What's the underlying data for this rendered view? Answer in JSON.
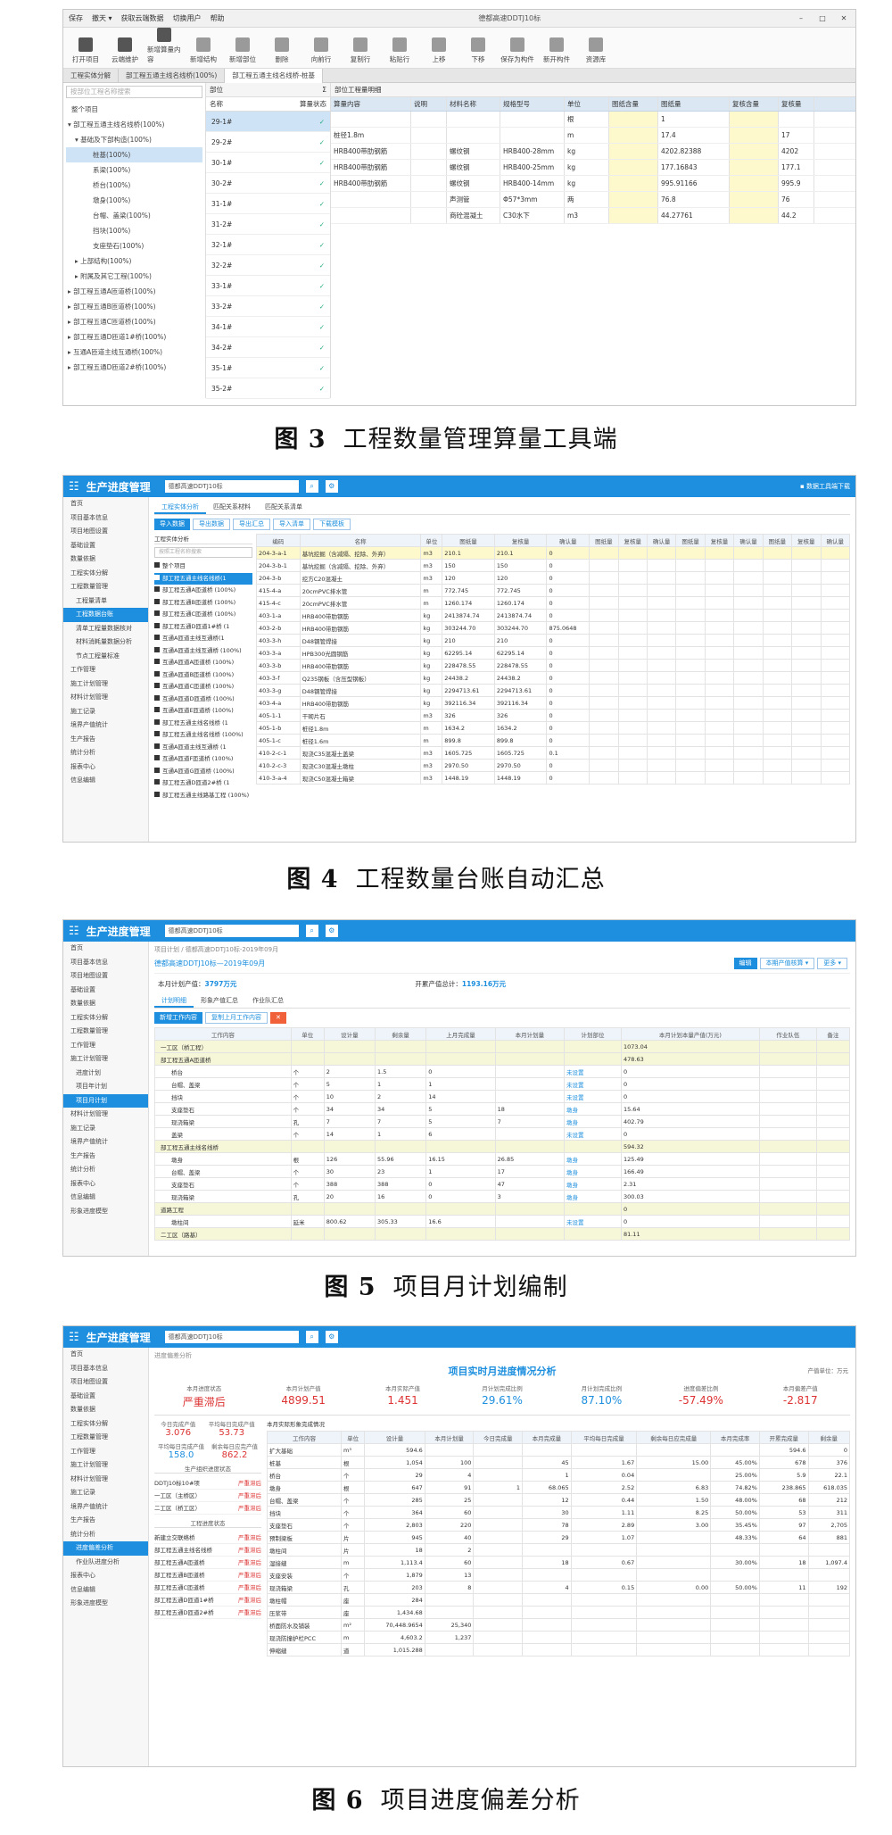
{
  "fig3": {
    "window_title": "德都高速DDTJ10标",
    "menu": [
      "保存",
      "撤天 ▾",
      "获取云端数据",
      "切换用户",
      "帮助"
    ],
    "ribbon": [
      "打开项目",
      "云端维护",
      "新增算量内容",
      "新增结构",
      "新增部位",
      "删除",
      "向前行",
      "复制行",
      "粘贴行",
      "上移",
      "下移",
      "保存为构件",
      "新开构件",
      "资源库"
    ],
    "tabs": [
      "工程实体分解",
      "部工程五通主线名线桥(100%)",
      "部工程五通主线名线桥-桩基"
    ],
    "tree_search": "按部位工程名称搜索",
    "tree": [
      "整个项目",
      "▾ 部工程五通主线名线桥(100%)",
      "▾ 基础及下部构造(100%)",
      "桩基(100%)",
      "系梁(100%)",
      "桥台(100%)",
      "墩身(100%)",
      "台帽、盖梁(100%)",
      "挡块(100%)",
      "支座垫石(100%)",
      "▸ 上部结构(100%)",
      "▸ 附属及其它工程(100%)",
      "▸ 部工程五通A匝道桥(100%)",
      "▸ 部工程五通B匝道桥(100%)",
      "▸ 部工程五通C匝道桥(100%)",
      "▸ 部工程五通D匝道1#桥(100%)",
      "▸ 互通A匝道主线互通桥(100%)",
      "▸ 部工程五通D匝道2#桥(100%)"
    ],
    "parts_header": "部位",
    "parts_cols": [
      "名称",
      "算量状态"
    ],
    "parts": [
      "29-1#",
      "29-2#",
      "30-1#",
      "30-2#",
      "31-1#",
      "31-2#",
      "32-1#",
      "32-2#",
      "33-1#",
      "33-2#",
      "34-1#",
      "34-2#",
      "35-1#",
      "35-2#"
    ],
    "grid_header": "部位工程量明细",
    "grid_cols": [
      "算量内容",
      "说明",
      "材料名称",
      "规格型号",
      "单位",
      "图纸含量",
      "图纸量",
      "复核含量",
      "复核量"
    ],
    "grid_rows": [
      [
        "",
        "",
        "",
        "",
        "根",
        "",
        "1",
        "",
        ""
      ],
      [
        "桩径1.8m",
        "",
        "",
        "",
        "m",
        "",
        "17.4",
        "",
        "17"
      ],
      [
        "HRB400带肋钢筋",
        "",
        "螺纹钢",
        "HRB400-28mm",
        "kg",
        "",
        "4202.82388",
        "",
        "4202"
      ],
      [
        "HRB400带肋钢筋",
        "",
        "螺纹钢",
        "HRB400-25mm",
        "kg",
        "",
        "177.16843",
        "",
        "177.1"
      ],
      [
        "HRB400带肋钢筋",
        "",
        "螺纹钢",
        "HRB400-14mm",
        "kg",
        "",
        "995.91166",
        "",
        "995.9"
      ],
      [
        "",
        "",
        "声测管",
        "Φ57*3mm",
        "两",
        "",
        "76.8",
        "",
        "76"
      ],
      [
        "",
        "",
        "商砼混凝土",
        "C30水下",
        "m3",
        "",
        "44.27761",
        "",
        "44.2"
      ]
    ]
  },
  "caption3": {
    "num": "图 3",
    "text": "工程数量管理算量工具端"
  },
  "caption4": {
    "num": "图 4",
    "text": "工程数量台账自动汇总"
  },
  "caption5": {
    "num": "图 5",
    "text": "项目月计划编制"
  },
  "caption6": {
    "num": "图 6",
    "text": "项目进度偏差分析"
  },
  "app": {
    "brand": "生产进度管理",
    "project": "德都高速DDTJ10标",
    "sidebar4": [
      "首页",
      "项目基本信息",
      "项目地图设置",
      "基础设置",
      "数量依据",
      "工程实体分解",
      "工程数量管理",
      "工程量清单",
      "工程数据台账",
      "清单工程量数据核对",
      "材料消耗量数据分析",
      "节点工程量标准",
      "工作管理",
      "施工计划管理",
      "材料计划管理",
      "施工记录",
      "境界产值统计",
      "生产报告",
      "统计分析",
      "报表中心",
      "信息编辑"
    ],
    "sidebar5": [
      "首页",
      "项目基本信息",
      "项目地图设置",
      "基础设置",
      "数量依据",
      "工程实体分解",
      "工程数量管理",
      "工作管理",
      "施工计划管理",
      "进度计划",
      "项目年计划",
      "项目月计划",
      "材料计划管理",
      "施工记录",
      "境界产值统计",
      "生产报告",
      "统计分析",
      "报表中心",
      "信息编辑",
      "形象进度模型"
    ],
    "sidebar6": [
      "首页",
      "项目基本信息",
      "项目地图设置",
      "基础设置",
      "数量依据",
      "工程实体分解",
      "工程数量管理",
      "工作管理",
      "施工计划管理",
      "材料计划管理",
      "施工记录",
      "境界产值统计",
      "生产报告",
      "统计分析",
      "进度偏差分析",
      "作业队进度分析",
      "报表中心",
      "信息编辑",
      "形象进度模型"
    ]
  },
  "fig4": {
    "top_right": "▪ 数据工具端下载",
    "tabs": [
      "工程实体分析",
      "匹配关系材料",
      "匹配关系清单"
    ],
    "buttons": [
      "导入数据",
      "导出数据",
      "导出汇总",
      "导入清单",
      "下载模板"
    ],
    "tree_title": "工程实体分析",
    "tree_search": "按照工程名称搜索",
    "tree": [
      "整个项目",
      "部工程五通主线名线桥(1",
      "部工程五通A匝道桥 (100%)",
      "部工程五通B匝道桥 (100%)",
      "部工程五通C匝道桥 (100%)",
      "部工程五通D匝道1#桥 (1",
      "互通A匝道主线互通桥(1",
      "互通A匝道主线互通桥 (100%)",
      "互通A匝道A匝道桥 (100%)",
      "互通A匝道B匝道桥 (100%)",
      "互通A匝道C匝道桥 (100%)",
      "互通A匝道D匝道桥 (100%)",
      "互通A匝道E匝道桥 (100%)",
      "部工程五通主线名线桥 (1",
      "部工程五通主线名线桥 (100%)",
      "互通A匝道主线互通桥 (1",
      "互通A匝道F匝道桥 (100%)",
      "互通A匝道G匝道桥 (100%)",
      "部工程五通D匝道2#桥 (1",
      "部工程五通主线路基工程 (100%)"
    ],
    "cols": [
      "编码",
      "名称",
      "单位",
      "图纸量",
      "复核量",
      "确认量",
      "图纸量",
      "复核量",
      "确认量",
      "图纸量",
      "复核量",
      "确认量",
      "图纸量",
      "复核量",
      "确认量"
    ],
    "rows": [
      [
        "204-3-a-1",
        "基坑挖掘（含减隔、挖除、外弃）",
        "m3",
        "210.1",
        "210.1",
        "0"
      ],
      [
        "204-3-b-1",
        "基坑挖掘（含减隔、挖除、外弃）",
        "m3",
        "150",
        "150",
        "0"
      ],
      [
        "204-3-b",
        "挖方C20混凝土",
        "m3",
        "120",
        "120",
        "0"
      ],
      [
        "415-4-a",
        "20cmPVC排水管",
        "m",
        "772.745",
        "772.745",
        "0"
      ],
      [
        "415-4-c",
        "20cmPVC排水管",
        "m",
        "1260.174",
        "1260.174",
        "0"
      ],
      [
        "403-1-a",
        "HRB400带肋钢筋",
        "kg",
        "2413874.74",
        "2413874.74",
        "0"
      ],
      [
        "403-2-b",
        "HRB400带肋钢筋",
        "kg",
        "303244.70",
        "303244.70",
        "875.0648"
      ],
      [
        "403-3-h",
        "D48钢管焊接",
        "kg",
        "210",
        "210",
        "0"
      ],
      [
        "403-3-a",
        "HPB300光圆钢筋",
        "kg",
        "62295.14",
        "62295.14",
        "0"
      ],
      [
        "403-3-b",
        "HRB400带肋钢筋",
        "kg",
        "228478.55",
        "228478.55",
        "0"
      ],
      [
        "403-3-f",
        "Q235钢板（含压型钢板）",
        "kg",
        "24438.2",
        "24438.2",
        "0"
      ],
      [
        "403-3-g",
        "D48钢管焊接",
        "kg",
        "2294713.61",
        "2294713.61",
        "0"
      ],
      [
        "403-4-a",
        "HRB400带肋钢筋",
        "kg",
        "392116.34",
        "392116.34",
        "0"
      ],
      [
        "405-1-1",
        "干砌片石",
        "m3",
        "326",
        "326",
        "0"
      ],
      [
        "405-1-b",
        "桩径1.8m",
        "m",
        "1634.2",
        "1634.2",
        "0"
      ],
      [
        "405-1-c",
        "桩径1.6m",
        "m",
        "899.8",
        "899.8",
        "0"
      ],
      [
        "410-2-c-1",
        "现浇C35混凝土盖梁",
        "m3",
        "1605.725",
        "1605.725",
        "0.1"
      ],
      [
        "410-2-c-3",
        "现浇C30混凝土墩柱",
        "m3",
        "2970.50",
        "2970.50",
        "0"
      ],
      [
        "410-3-a-4",
        "现浇C50混凝土箱梁",
        "m3",
        "1448.19",
        "1448.19",
        "0"
      ]
    ]
  },
  "fig5": {
    "breadcrumb": "项目计划 / 德都高速DDTJ10标-2019年09月",
    "title": "德都高速DDTJ10标—2019年09月",
    "month_output_label": "本月计划产值：",
    "month_output": "3797万元",
    "cum_output_label": "开累产值总计：",
    "cum_output": "1193.16万元",
    "right_buttons": [
      "编辑",
      "本期产值核算 ▾",
      "更多 ▾"
    ],
    "tabs": [
      "计划明细",
      "形象产值汇总",
      "作业队汇总"
    ],
    "buttons": [
      "新增工作内容",
      "复制上月工作内容"
    ],
    "cols": [
      "工作内容",
      "单位",
      "设计量",
      "剩余量",
      "上月完成量",
      "本月计划量",
      "计划部位",
      "本月计划本量产值(万元)",
      "作业队伍",
      "备注"
    ],
    "rows": [
      [
        "一工区（桥工程）",
        "",
        "",
        "",
        "",
        "",
        "",
        "1073.04",
        "",
        ""
      ],
      [
        "部工程五通A匝道桥",
        "",
        "",
        "",
        "",
        "",
        "",
        "478.63",
        "",
        ""
      ],
      [
        "桥台",
        "个",
        "2",
        "1.5",
        "0",
        "",
        "未设置",
        "0",
        "",
        ""
      ],
      [
        "台帽、盖梁",
        "个",
        "5",
        "1",
        "1",
        "",
        "未设置",
        "0",
        "",
        ""
      ],
      [
        "挡块",
        "个",
        "10",
        "2",
        "14",
        "",
        "未设置",
        "0",
        "",
        ""
      ],
      [
        "支座垫石",
        "个",
        "34",
        "34",
        "5",
        "18",
        "墩身",
        "15.64",
        "",
        ""
      ],
      [
        "现浇箱梁",
        "孔",
        "7",
        "7",
        "5",
        "7",
        "墩身",
        "402.79",
        "",
        ""
      ],
      [
        "盖梁",
        "个",
        "14",
        "1",
        "6",
        "",
        "未设置",
        "0",
        "",
        ""
      ],
      [
        "部工程五通主线名线桥",
        "",
        "",
        "",
        "",
        "",
        "",
        "594.32",
        "",
        ""
      ],
      [
        "墩身",
        "根",
        "126",
        "55.96",
        "16.15",
        "26.85",
        "墩身",
        "125.49",
        "",
        ""
      ],
      [
        "台帽、盖梁",
        "个",
        "30",
        "23",
        "1",
        "17",
        "墩身",
        "166.49",
        "",
        ""
      ],
      [
        "支座垫石",
        "个",
        "388",
        "388",
        "0",
        "47",
        "墩身",
        "2.31",
        "",
        ""
      ],
      [
        "现浇箱梁",
        "孔",
        "20",
        "16",
        "0",
        "3",
        "墩身",
        "300.03",
        "",
        ""
      ],
      [
        "道路工程",
        "",
        "",
        "",
        "",
        "",
        "",
        "0",
        "",
        ""
      ],
      [
        "墩柱间",
        "延米",
        "800.62",
        "305.33",
        "16.6",
        "",
        "未设置",
        "0",
        "",
        ""
      ],
      [
        "二工区（路基）",
        "",
        "",
        "",
        "",
        "",
        "",
        "81.11",
        "",
        ""
      ]
    ]
  },
  "fig6": {
    "breadcrumb": "进度偏差分析",
    "title": "项目实时月进度情况分析",
    "unit": "产值单位：万元",
    "kpis": [
      {
        "label": "本月进度状态",
        "value": "严重滞后"
      },
      {
        "label": "本月计划产值",
        "value": "4899.51"
      },
      {
        "label": "本月实际产值",
        "value": "1.451"
      },
      {
        "label": "月计划完成比例",
        "value": "29.61%"
      },
      {
        "label": "月计划完成比例",
        "value": "87.10%"
      },
      {
        "label": "进度偏差比例",
        "value": "-57.49%"
      },
      {
        "label": "本月偏差产值",
        "value": "-2.817"
      }
    ],
    "left_stats": [
      {
        "l1": "今日完成产值",
        "v1": "3.076",
        "l2": "平均每日完成产值",
        "v2": "53.73"
      },
      {
        "l1": "平均每日完成产值",
        "v1": "158.0",
        "l2": "剩余每日应完产值",
        "v2": "862.2"
      }
    ],
    "left_header1": "生产组织进度状态",
    "left_list1": [
      [
        "DDTJ10标10#项",
        "严重滞后"
      ],
      [
        "一工区（主桥区）",
        "严重滞后"
      ],
      [
        "二工区（桥工区）",
        "严重滞后"
      ]
    ],
    "left_header2": "工程进度状态",
    "left_list2": [
      [
        "新建立交联络桥",
        "严重滞后"
      ],
      [
        "部工程五通主线名线桥",
        "严重滞后"
      ],
      [
        "部工程五通A匝道桥",
        "严重滞后"
      ],
      [
        "部工程五通B匝道桥",
        "严重滞后"
      ],
      [
        "部工程五通C匝道桥",
        "严重滞后"
      ],
      [
        "部工程五通D匝道1#桥",
        "严重滞后"
      ],
      [
        "部工程五通D匝道2#桥",
        "严重滞后"
      ]
    ],
    "table_caption": "本月实际形象完成情况",
    "cols": [
      "工作内容",
      "单位",
      "设计量",
      "本月计划量",
      "今日完成量",
      "本月完成量",
      "平均每日完成量",
      "剩余每日应完成量",
      "本月完成率",
      "开累完成量",
      "剩余量"
    ],
    "rows": [
      [
        "扩大基础",
        "m³",
        "594.6",
        "",
        "",
        "",
        "",
        "",
        "",
        "594.6",
        "0"
      ],
      [
        "桩基",
        "根",
        "1,054",
        "100",
        "",
        "45",
        "1.67",
        "15.00",
        "45.00%",
        "678",
        "376"
      ],
      [
        "桥台",
        "个",
        "29",
        "4",
        "",
        "1",
        "0.04",
        "",
        "25.00%",
        "5.9",
        "22.1"
      ],
      [
        "墩身",
        "根",
        "647",
        "91",
        "1",
        "68.065",
        "2.52",
        "6.83",
        "74.82%",
        "238.865",
        "618.035"
      ],
      [
        "台帽、盖梁",
        "个",
        "285",
        "25",
        "",
        "12",
        "0.44",
        "1.50",
        "48.00%",
        "68",
        "212"
      ],
      [
        "挡块",
        "个",
        "364",
        "60",
        "",
        "30",
        "1.11",
        "8.25",
        "50.00%",
        "53",
        "311"
      ],
      [
        "支座垫石",
        "个",
        "2,803",
        "220",
        "",
        "78",
        "2.89",
        "3.00",
        "35.45%",
        "97",
        "2,705"
      ],
      [
        "预制梁板",
        "片",
        "945",
        "40",
        "",
        "29",
        "1.07",
        "",
        "48.33%",
        "64",
        "881"
      ],
      [
        "墩柱间",
        "片",
        "18",
        "2",
        "",
        "",
        "",
        "",
        "",
        "",
        ""
      ],
      [
        "湿接缝",
        "m",
        "1,113.4",
        "60",
        "",
        "18",
        "0.67",
        "",
        "30.00%",
        "18",
        "1,097.4"
      ],
      [
        "支座安装",
        "个",
        "1,879",
        "13",
        "",
        "",
        "",
        "",
        "",
        "",
        ""
      ],
      [
        "现浇箱梁",
        "孔",
        "203",
        "8",
        "",
        "4",
        "0.15",
        "0.00",
        "50.00%",
        "11",
        "192"
      ],
      [
        "墩柱帽",
        "座",
        "284",
        "",
        "",
        "",
        "",
        "",
        "",
        "",
        ""
      ],
      [
        "压浆带",
        "座",
        "1,434.68",
        "",
        "",
        "",
        "",
        "",
        "",
        "",
        ""
      ],
      [
        "桥面防水及铺装",
        "m²",
        "70,448.9654",
        "25,340",
        "",
        "",
        "",
        "",
        "",
        "",
        ""
      ],
      [
        "现浇防撞护栏PCC",
        "m",
        "4,603.2",
        "1,237",
        "",
        "",
        "",
        "",
        "",
        "",
        ""
      ],
      [
        "伸缩缝",
        "道",
        "1,015.288",
        "",
        "",
        "",
        "",
        "",
        "",
        "",
        ""
      ]
    ]
  }
}
